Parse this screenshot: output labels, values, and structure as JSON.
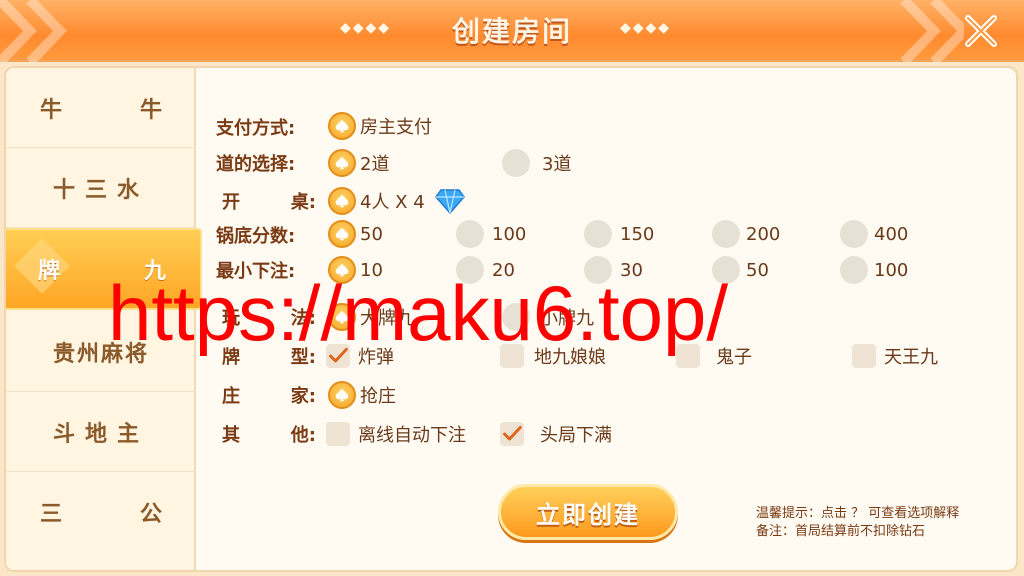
{
  "header": {
    "title": "创建房间",
    "deco_left": "◆◆◆◆",
    "deco_right": "◆◆◆◆"
  },
  "sidebar": {
    "items": [
      {
        "label_a": "牛",
        "label_b": "牛"
      },
      {
        "label": "十三水"
      },
      {
        "label_a": "牌",
        "label_b": "九",
        "active": true
      },
      {
        "label": "贵州麻将"
      },
      {
        "label": "斗地主"
      },
      {
        "label_a": "三",
        "label_b": "公"
      }
    ]
  },
  "form": {
    "payment": {
      "label": "支付方式:",
      "options": [
        "房主支付"
      ]
    },
    "road": {
      "label": "道的选择:",
      "options": [
        "2道",
        "3道"
      ]
    },
    "table": {
      "label_a": "开",
      "label_b": "桌:",
      "options": [
        "4人 X 4"
      ]
    },
    "base_score": {
      "label": "锅底分数:",
      "options": [
        "50",
        "100",
        "150",
        "200",
        "400"
      ]
    },
    "min_bet": {
      "label": "最小下注:",
      "options": [
        "10",
        "20",
        "30",
        "50",
        "100"
      ]
    },
    "play_mode": {
      "label_a": "玩",
      "label_b": "法:",
      "options": [
        "大牌九",
        "小牌九"
      ]
    },
    "card_type": {
      "label_a": "牌",
      "label_b": "型:",
      "options": [
        "炸弹",
        "地九娘娘",
        "鬼子",
        "天王九"
      ]
    },
    "banker": {
      "label_a": "庄",
      "label_b": "家:",
      "options": [
        "抢庄"
      ]
    },
    "other": {
      "label_a": "其",
      "label_b": "他:",
      "options": [
        "离线自动下注",
        "头局下满"
      ]
    }
  },
  "create_button": "立即创建",
  "tips": {
    "line1": "温馨提示：点击 ？ 可查看选项解释",
    "line2": "备注：首局结算前不扣除钻石"
  },
  "watermark": "https://maku6.top/",
  "colors": {
    "accent": "#ff9a1f",
    "label": "#7a3b14",
    "watermark": "#ff0000"
  }
}
